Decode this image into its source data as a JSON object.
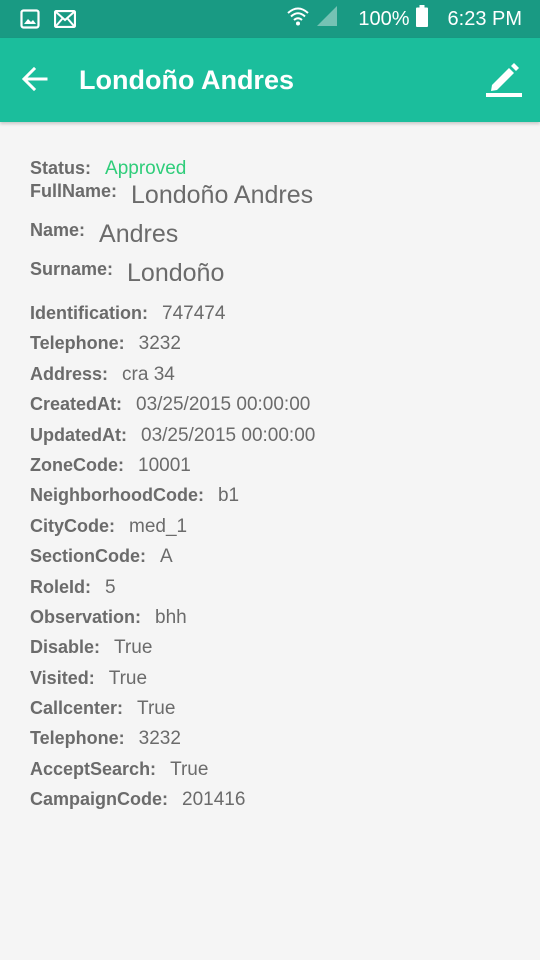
{
  "status_bar": {
    "battery": "100%",
    "time": "6:23 PM"
  },
  "app_bar": {
    "title": "Londoño Andres"
  },
  "details": {
    "status": {
      "label": "Status:",
      "value": "Approved"
    },
    "full_name": {
      "label": "FullName:",
      "value": "Londoño Andres"
    },
    "name": {
      "label": "Name:",
      "value": "Andres"
    },
    "surname": {
      "label": "Surname:",
      "value": "Londoño"
    },
    "fields": [
      {
        "label": "Identification:",
        "value": "747474"
      },
      {
        "label": "Telephone:",
        "value": "3232"
      },
      {
        "label": "Address:",
        "value": "cra 34"
      },
      {
        "label": "CreatedAt:",
        "value": "03/25/2015 00:00:00"
      },
      {
        "label": "UpdatedAt:",
        "value": "03/25/2015 00:00:00"
      },
      {
        "label": "ZoneCode:",
        "value": "10001"
      },
      {
        "label": "NeighborhoodCode:",
        "value": "b1"
      },
      {
        "label": "CityCode:",
        "value": "med_1"
      },
      {
        "label": "SectionCode:",
        "value": "A"
      },
      {
        "label": "RoleId:",
        "value": "5"
      },
      {
        "label": "Observation:",
        "value": "bhh"
      },
      {
        "label": "Disable:",
        "value": "True"
      },
      {
        "label": "Visited:",
        "value": "True"
      },
      {
        "label": "Callcenter:",
        "value": "True"
      },
      {
        "label": "Telephone:",
        "value": "3232"
      },
      {
        "label": "AcceptSearch:",
        "value": "True"
      },
      {
        "label": "CampaignCode:",
        "value": "201416"
      }
    ]
  },
  "colors": {
    "status_bar": "#199a83",
    "app_bar": "#1bbe9c",
    "approved": "#2fcd7a",
    "text": "#6b6b6b",
    "background": "#f5f5f5"
  },
  "icons": [
    "image-icon",
    "mail-icon",
    "wifi-icon",
    "signal-icon",
    "battery-icon",
    "back-arrow-icon",
    "edit-pencil-icon"
  ]
}
